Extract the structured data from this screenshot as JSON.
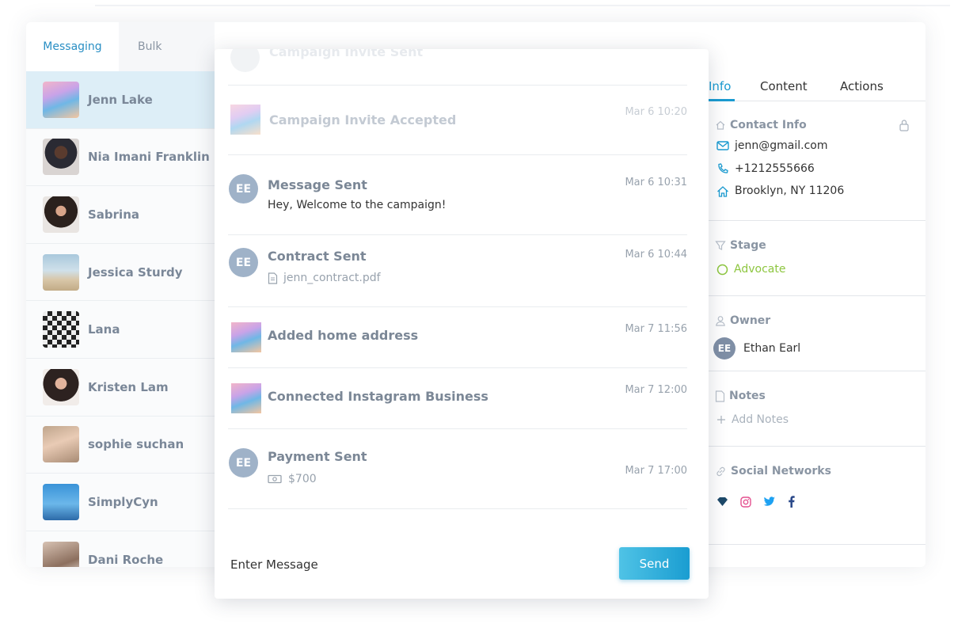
{
  "tabs": {
    "messaging": "Messaging",
    "bulk": "Bulk"
  },
  "contacts": [
    {
      "name": "Jenn Lake"
    },
    {
      "name": "Nia Imani Franklin"
    },
    {
      "name": "Sabrina"
    },
    {
      "name": "Jessica Sturdy"
    },
    {
      "name": "Lana"
    },
    {
      "name": "Kristen Lam"
    },
    {
      "name": "sophie suchan"
    },
    {
      "name": "SimplyCyn"
    },
    {
      "name": "Dani Roche"
    }
  ],
  "timeline": {
    "hidden_entry": "Campaign Invite Sent",
    "entries": [
      {
        "title": "Campaign Invite Accepted",
        "time": "Mar 6 10:20"
      },
      {
        "initials": "EE",
        "title": "Message Sent",
        "subtitle": "Hey, Welcome to the campaign!",
        "time": "Mar 6 10:31"
      },
      {
        "initials": "EE",
        "title": "Contract Sent",
        "subtitle": "jenn_contract.pdf",
        "time": "Mar 6 10:44"
      },
      {
        "title": "Added home address",
        "time": "Mar 7 11:56"
      },
      {
        "title": "Connected Instagram Business",
        "time": "Mar 7 12:00"
      },
      {
        "initials": "EE",
        "title": "Payment Sent",
        "subtitle": "$700",
        "time": "Mar 7 17:00"
      }
    ]
  },
  "composer": {
    "placeholder": "Enter Message",
    "send_label": "Send"
  },
  "right_tabs": {
    "info": "Info",
    "content": "Content",
    "actions": "Actions"
  },
  "contact_info": {
    "title": "Contact Info",
    "email": "jenn@gmail.com",
    "phone": "+1212555666",
    "address": "Brooklyn, NY 11206"
  },
  "stage": {
    "title": "Stage",
    "value": "Advocate",
    "color": "#8dc63f"
  },
  "owner": {
    "title": "Owner",
    "initials": "EE",
    "name": "Ethan Earl"
  },
  "notes": {
    "title": "Notes",
    "add_label": "Add Notes"
  },
  "social": {
    "title": "Social Networks",
    "icons": [
      "gem-icon",
      "instagram-icon",
      "twitter-icon",
      "facebook-icon"
    ]
  },
  "colors": {
    "accent": "#1a9bd1",
    "active_row": "#ddeef7",
    "muted": "#8a95a3"
  }
}
